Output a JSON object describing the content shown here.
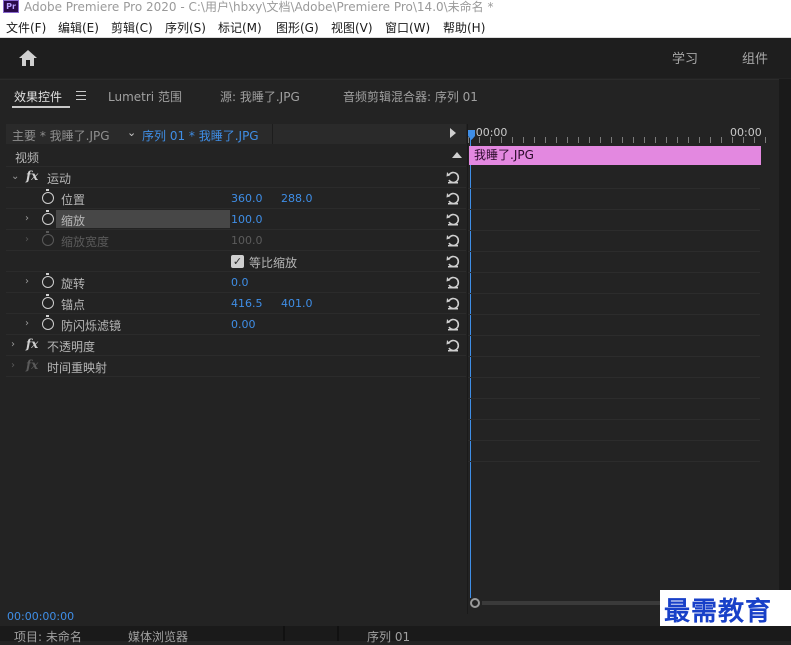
{
  "window": {
    "app_badge": "Pr",
    "title": "Adobe Premiere Pro 2020 - C:\\用户\\hbxy\\文档\\Adobe\\Premiere Pro\\14.0\\未命名 *"
  },
  "menu": [
    "文件(F)",
    "编辑(E)",
    "剪辑(C)",
    "序列(S)",
    "标记(M)",
    "图形(G)",
    "视图(V)",
    "窗口(W)",
    "帮助(H)"
  ],
  "workspace": {
    "learn": "学习",
    "assembly": "组件"
  },
  "panel_tabs": {
    "effect_controls": "效果控件",
    "lumetri_scopes": "Lumetri 范围",
    "source": "源: 我睡了.JPG",
    "audio_clip_mixer": "音频剪辑混合器: 序列 01"
  },
  "source_row": {
    "master": "主要 * 我睡了.JPG",
    "sequence_clip": "序列 01 * 我睡了.JPG"
  },
  "effects": {
    "video_header": "视频",
    "motion": "运动",
    "position_label": "位置",
    "position_x": "360.0",
    "position_y": "288.0",
    "scale_label": "缩放",
    "scale_value": "100.0",
    "scale_width_label": "缩放宽度",
    "scale_width_value": "100.0",
    "uniform_scale_label": "等比缩放",
    "uniform_scale_checked": true,
    "rotation_label": "旋转",
    "rotation_value": "0.0",
    "anchor_label": "锚点",
    "anchor_x": "416.5",
    "anchor_y": "401.0",
    "anti_flicker_label": "防闪烁滤镜",
    "anti_flicker_value": "0.00",
    "opacity": "不透明度",
    "time_remap": "时间重映射"
  },
  "timeline": {
    "start_label": ":00:00",
    "end_label": "00:00",
    "clip_name": "我睡了.JPG",
    "clip_color": "#e388e0",
    "playhead_color": "#3f8ee6"
  },
  "timecode": "00:00:00:00",
  "bottom_tabs": {
    "project": "项目: 未命名",
    "media_browser": "媒体浏览器",
    "sequence": "序列 01"
  },
  "watermark": "最需教育"
}
